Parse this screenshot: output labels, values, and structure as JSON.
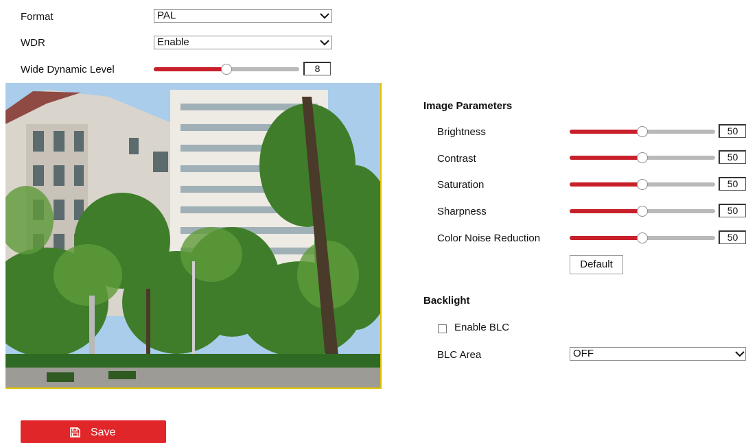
{
  "video": {
    "format_label": "Format",
    "format_value": "PAL",
    "wdr_label": "WDR",
    "wdr_value": "Enable",
    "wide_dynamic_label": "Wide Dynamic Level",
    "wide_dynamic_value": "8",
    "wide_dynamic_fraction": 0.5
  },
  "image_params": {
    "heading": "Image Parameters",
    "items": [
      {
        "label": "Brightness",
        "value": "50",
        "fraction": 0.5
      },
      {
        "label": "Contrast",
        "value": "50",
        "fraction": 0.5
      },
      {
        "label": "Saturation",
        "value": "50",
        "fraction": 0.5
      },
      {
        "label": "Sharpness",
        "value": "50",
        "fraction": 0.5
      },
      {
        "label": "Color Noise Reduction",
        "value": "50",
        "fraction": 0.5
      }
    ],
    "default_button": "Default"
  },
  "backlight": {
    "heading": "Backlight",
    "enable_blc_label": "Enable BLC",
    "enable_blc_checked": false,
    "blc_area_label": "BLC Area",
    "blc_area_value": "OFF"
  },
  "save_button": "Save",
  "icons": {
    "dropdown": "chevron-down-icon",
    "save": "floppy-disk-icon"
  },
  "colors": {
    "accent": "#e1262a",
    "slider_fill": "#c8202a",
    "slider_track": "#b9b9b9",
    "preview_border": "#e2c100"
  }
}
